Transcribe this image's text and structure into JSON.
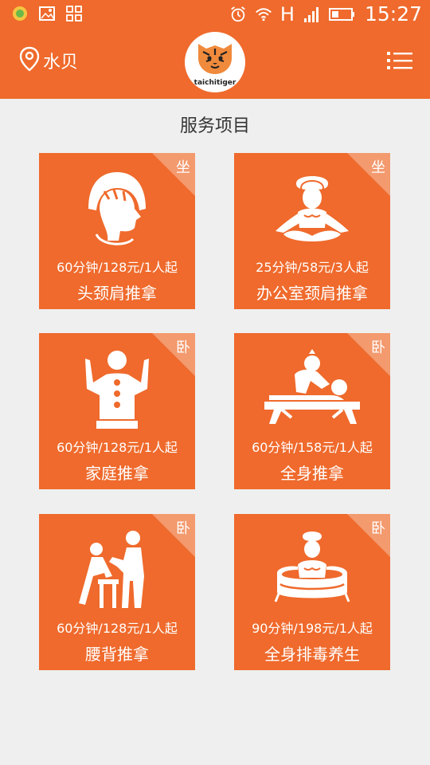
{
  "status_bar": {
    "signal_text": "H",
    "time": "15:27"
  },
  "header": {
    "location": "水贝",
    "logo_text": "taichitiger"
  },
  "section_title": "服务项目",
  "services": [
    {
      "tag": "坐",
      "price": "60分钟/128元/1人起",
      "name": "头颈肩推拿",
      "icon": "head-massage-icon"
    },
    {
      "tag": "坐",
      "price": "25分钟/58元/3人起",
      "name": "办公室颈肩推拿",
      "icon": "meditation-icon"
    },
    {
      "tag": "卧",
      "price": "60分钟/128元/1人起",
      "name": "家庭推拿",
      "icon": "back-points-icon"
    },
    {
      "tag": "卧",
      "price": "60分钟/158元/1人起",
      "name": "全身推拿",
      "icon": "body-massage-icon"
    },
    {
      "tag": "卧",
      "price": "60分钟/128元/1人起",
      "name": "腰背推拿",
      "icon": "back-massage-icon"
    },
    {
      "tag": "卧",
      "price": "90分钟/198元/1人起",
      "name": "全身排毒养生",
      "icon": "bath-icon"
    }
  ],
  "colors": {
    "brand": "#ef6a2c",
    "corner": "#f39a6e",
    "background": "#efefef"
  }
}
